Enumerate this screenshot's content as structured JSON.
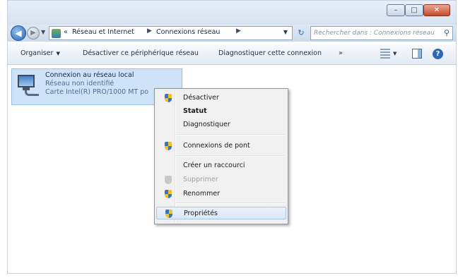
{
  "window": {
    "controls": {
      "minimize": "–",
      "maximize": "□",
      "close": "✕"
    }
  },
  "nav": {
    "back_icon": "arrow-left-icon",
    "forward_icon": "arrow-right-icon",
    "breadcrumb": {
      "prefix": "«",
      "items": [
        "Réseau et Internet",
        "Connexions réseau"
      ]
    },
    "search_placeholder": "Rechercher dans : Connexions réseau"
  },
  "toolbar": {
    "organize": "Organiser",
    "disable_device": "Désactiver ce périphérique réseau",
    "diagnose": "Diagnostiquer cette connexion",
    "more": "»"
  },
  "connection": {
    "name": "Connexion au réseau local",
    "status": "Réseau non identifié",
    "adapter": "Carte Intel(R) PRO/1000 MT po"
  },
  "context_menu": {
    "items": [
      {
        "label": "Désactiver",
        "icon": "shield-icon",
        "bold": false,
        "disabled": false
      },
      {
        "label": "Statut",
        "icon": "",
        "bold": true,
        "disabled": false
      },
      {
        "label": "Diagnostiquer",
        "icon": "",
        "bold": false,
        "disabled": false
      },
      {
        "label": "Connexions de pont",
        "icon": "shield-icon",
        "bold": false,
        "disabled": false
      },
      {
        "label": "Créer un raccourci",
        "icon": "",
        "bold": false,
        "disabled": false
      },
      {
        "label": "Supprimer",
        "icon": "shield-icon",
        "bold": false,
        "disabled": true
      },
      {
        "label": "Renommer",
        "icon": "shield-icon",
        "bold": false,
        "disabled": false
      },
      {
        "label": "Propriétés",
        "icon": "shield-icon",
        "bold": false,
        "disabled": false,
        "highlighted": true
      }
    ]
  },
  "colors": {
    "selection": "#cfe3f8",
    "menu_background": "#f0f0f0",
    "close_button": "#c54b2b"
  }
}
